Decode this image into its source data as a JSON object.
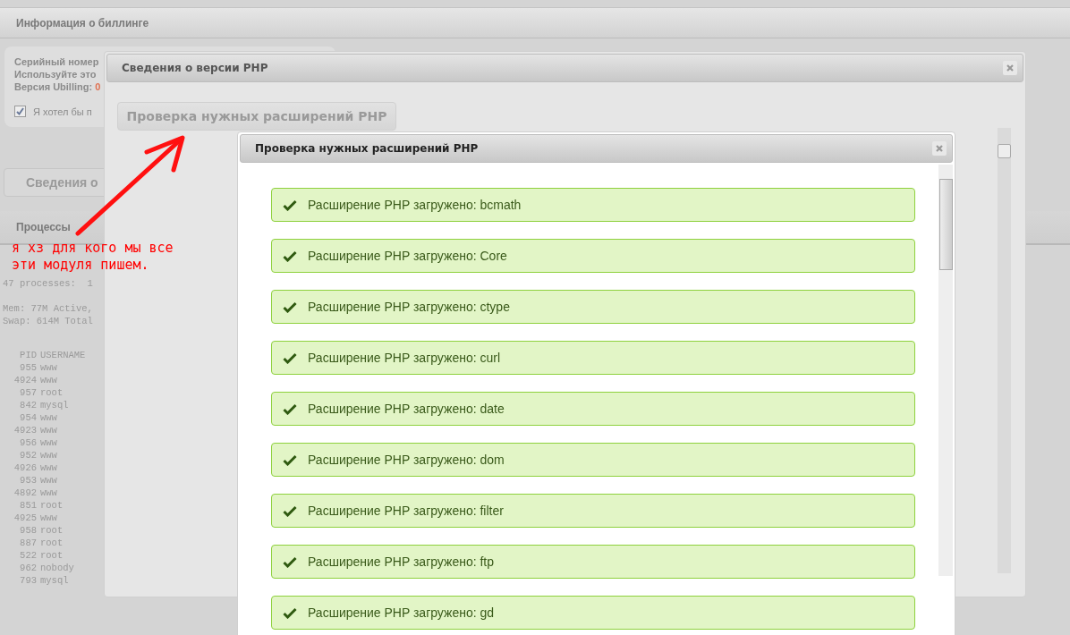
{
  "page": {
    "title": "Информация о биллинге",
    "info": {
      "lines": [
        "Серийный номер",
        "Используйте это"
      ],
      "version_label": "Версия Ubilling: ",
      "version_value": "0",
      "checkbox": {
        "label": "Я хотел бы п",
        "checked": true
      }
    },
    "button": "Сведения о",
    "processes": {
      "title": "Процессы",
      "header_lines": [
        "47 processes:  1",
        "Mem: 77M Active,",
        "Swap: 614M Total"
      ],
      "columns": [
        "PID",
        "USERNAME"
      ],
      "rows": [
        [
          "955",
          "www"
        ],
        [
          "4924",
          "www"
        ],
        [
          "957",
          "root"
        ],
        [
          "842",
          "mysql"
        ],
        [
          "954",
          "www"
        ],
        [
          "4923",
          "www"
        ],
        [
          "956",
          "www"
        ],
        [
          "952",
          "www"
        ],
        [
          "4926",
          "www"
        ],
        [
          "953",
          "www"
        ],
        [
          "4892",
          "www"
        ],
        [
          "851",
          "root"
        ],
        [
          "4925",
          "www"
        ],
        [
          "958",
          "root"
        ],
        [
          "887",
          "root"
        ],
        [
          "522",
          "root"
        ],
        [
          "962",
          "nobody"
        ],
        [
          "793",
          "mysql"
        ]
      ]
    }
  },
  "annotation": {
    "lines": [
      "я хз для кого мы все",
      "эти модуля пишем."
    ]
  },
  "dialog": {
    "title": "Сведения о версии PHP",
    "button": "Проверка нужных расширений PHP"
  },
  "inner_dialog": {
    "title": "Проверка нужных расширений PHP",
    "items": [
      {
        "text": "Расширение PHP загружено: bcmath",
        "ok": true
      },
      {
        "text": "Расширение PHP загружено: Core",
        "ok": true
      },
      {
        "text": "Расширение PHP загружено: ctype",
        "ok": true
      },
      {
        "text": "Расширение PHP загружено: curl",
        "ok": true
      },
      {
        "text": "Расширение PHP загружено: date",
        "ok": true
      },
      {
        "text": "Расширение PHP загружено: dom",
        "ok": true
      },
      {
        "text": "Расширение PHP загружено: filter",
        "ok": true
      },
      {
        "text": "Расширение PHP загружено: ftp",
        "ok": true
      },
      {
        "text": "Расширение PHP загружено: gd",
        "ok": true
      }
    ]
  }
}
